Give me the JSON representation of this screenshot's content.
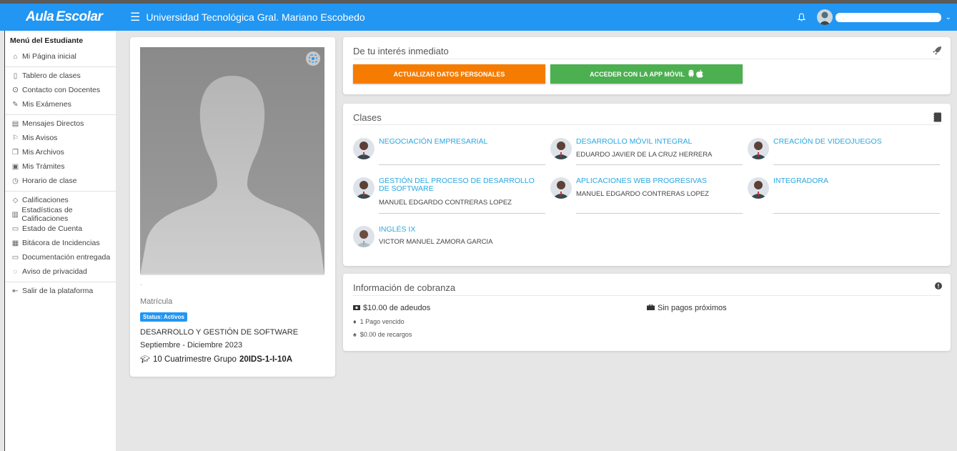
{
  "brand": {
    "name_part1": "Aula",
    "name_part2": "Escolar"
  },
  "header": {
    "school": "Universidad Tecnológica Gral. Mariano Escobedo"
  },
  "sidebar": {
    "title": "Menú del Estudiante",
    "groups": [
      [
        {
          "label": "Mi Página inicial",
          "icon": "home-icon"
        }
      ],
      [
        {
          "label": "Tablero de clases",
          "icon": "board-icon"
        },
        {
          "label": "Contacto con Docentes",
          "icon": "glasses-icon"
        },
        {
          "label": "Mis Exámenes",
          "icon": "pencil-icon"
        }
      ],
      [
        {
          "label": "Mensajes Directos",
          "icon": "message-icon"
        },
        {
          "label": "Mis Avisos",
          "icon": "flag-icon"
        },
        {
          "label": "Mis Archivos",
          "icon": "files-icon"
        },
        {
          "label": "Mis Trámites",
          "icon": "forms-icon"
        },
        {
          "label": "Horario de clase",
          "icon": "clock-icon"
        }
      ],
      [
        {
          "label": "Calificaciones",
          "icon": "graduation-icon"
        },
        {
          "label": "Estadísticas de Calificaciones",
          "icon": "stats-icon"
        },
        {
          "label": "Estado de Cuenta",
          "icon": "card-icon"
        },
        {
          "label": "Bitácora de Incidencias",
          "icon": "log-icon"
        },
        {
          "label": "Documentación entregada",
          "icon": "folder-icon"
        },
        {
          "label": "Aviso de privacidad",
          "icon": "shield-icon"
        }
      ],
      [
        {
          "label": "Salir de la plataforma",
          "icon": "logout-icon"
        }
      ]
    ]
  },
  "profile": {
    "dot": ".",
    "matricula_label": "Matrícula",
    "status": "Status: Activos",
    "carrera": "DESARROLLO Y GESTIÓN DE SOFTWARE",
    "periodo": "Septiembre - Diciembre 2023",
    "grupo_prefix": "10 Cuatrimestre Grupo",
    "grupo": "20IDS-1-I-10A"
  },
  "interest": {
    "title": "De tu interés inmediato",
    "btn_update": "ACTUALIZAR DATOS PERSONALES",
    "btn_app": "ACCEDER CON LA APP MÓVIL"
  },
  "clases": {
    "title": "Clases",
    "items": [
      {
        "name": "NEGOCIACIÓN EMPRESARIAL",
        "teacher": ""
      },
      {
        "name": "DESARROLLO MÓVIL INTEGRAL",
        "teacher": "EDUARDO JAVIER DE LA CRUZ HERRERA"
      },
      {
        "name": "CREACIÓN DE VIDEOJUEGOS",
        "teacher": ""
      },
      {
        "name": "GESTIÓN DEL PROCESO DE DESARROLLO DE SOFTWARE",
        "teacher": "MANUEL EDGARDO CONTRERAS LOPEZ"
      },
      {
        "name": "APLICACIONES WEB PROGRESIVAS",
        "teacher": "MANUEL EDGARDO CONTRERAS LOPEZ"
      },
      {
        "name": "INTEGRADORA",
        "teacher": ""
      },
      {
        "name": "INGLÉS IX",
        "teacher": "VICTOR MANUEL ZAMORA GARCIA"
      }
    ]
  },
  "cobranza": {
    "title": "Información de cobranza",
    "adeudos": "$10.00 de adeudos",
    "vencido": "1 Pago vencido",
    "recargos": "$0.00 de recargos",
    "proximos": "Sin pagos próximos"
  },
  "colors": {
    "primary": "#2196f3",
    "orange": "#f57c00",
    "green": "#4caf50",
    "link": "#2aa7e0"
  }
}
